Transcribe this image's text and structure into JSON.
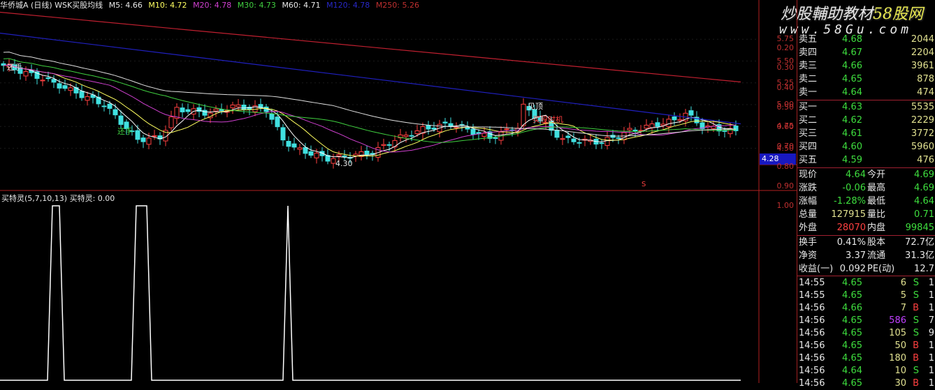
{
  "header": {
    "stock": "华侨城A (日线) WSK买股均线",
    "m5": "M5: 4.66",
    "m10": "M10: 4.72",
    "m20": "M20: 4.78",
    "m30": "M30: 4.73",
    "m60": "M60: 4.71",
    "m120": "M120: 4.78",
    "m250": "M250: 5.26"
  },
  "colors": {
    "m5": "#ffffff",
    "m10": "#ffff60",
    "m20": "#d040d0",
    "m30": "#40d040",
    "m60": "#e0e0e0",
    "m120": "#2020c0",
    "m250": "#c02030",
    "up": "#ff4040",
    "down": "#40e0e0"
  },
  "watermark": {
    "line1": "炒股輔助教材",
    "line1b": "58股网",
    "line2": "www.58Gu.com"
  },
  "price_axis": [
    "5.75",
    "5.50",
    "5.25",
    "5.00",
    "4.75",
    "4.50"
  ],
  "cursor_price": "4.28",
  "annotations": {
    "low": "4.30",
    "peak": "见顶",
    "buy": "买股时机",
    "left": "还手",
    "s_mark": "S"
  },
  "indicator": {
    "title": "买特灵(5,7,10,13)",
    "value": "买特灵: 0.00",
    "axis": [
      "1.00",
      "0.90",
      "0.80",
      "0.70",
      "0.60",
      "0.50",
      "0.40",
      "0.30",
      "0.20"
    ]
  },
  "chart_data": {
    "type": "candlestick",
    "price_path": [
      [
        0,
        5.45
      ],
      [
        7,
        5.3
      ],
      [
        18,
        5.0
      ],
      [
        24,
        4.6
      ],
      [
        28,
        4.62
      ],
      [
        31,
        4.95
      ],
      [
        37,
        4.9
      ],
      [
        41,
        4.98
      ],
      [
        47,
        4.95
      ],
      [
        50,
        4.6
      ],
      [
        52,
        4.5
      ],
      [
        58,
        4.38
      ],
      [
        66,
        4.45
      ],
      [
        70,
        4.6
      ],
      [
        75,
        4.72
      ],
      [
        80,
        4.78
      ],
      [
        87,
        4.62
      ],
      [
        92,
        4.75
      ],
      [
        93,
        4.98
      ],
      [
        100,
        4.6
      ],
      [
        107,
        4.57
      ],
      [
        112,
        4.7
      ],
      [
        120,
        4.82
      ],
      [
        122,
        4.9
      ],
      [
        125,
        4.75
      ],
      [
        132,
        4.68
      ]
    ],
    "m120": [
      5.82,
      4.78
    ],
    "m250": [
      6.06,
      5.26
    ],
    "indicator_spikes": [
      [
        68,
        75,
        85,
        92
      ],
      [
        188,
        195,
        210,
        217
      ],
      [
        405,
        412,
        412,
        419
      ]
    ]
  },
  "quote": {
    "asks": [
      {
        "l": "卖五",
        "p": "4.68",
        "v": "2044"
      },
      {
        "l": "卖四",
        "p": "4.67",
        "v": "2204"
      },
      {
        "l": "卖三",
        "p": "4.66",
        "v": "3961"
      },
      {
        "l": "卖二",
        "p": "4.65",
        "v": "878"
      },
      {
        "l": "卖一",
        "p": "4.64",
        "v": "474"
      }
    ],
    "bids": [
      {
        "l": "买一",
        "p": "4.63",
        "v": "5535"
      },
      {
        "l": "买二",
        "p": "4.62",
        "v": "2229"
      },
      {
        "l": "买三",
        "p": "4.61",
        "v": "3772"
      },
      {
        "l": "买四",
        "p": "4.60",
        "v": "5960"
      },
      {
        "l": "买五",
        "p": "4.59",
        "v": "476"
      }
    ],
    "stats": [
      {
        "a": "现价",
        "av": "4.64",
        "b": "今开",
        "bv": "4.69",
        "ac": "g",
        "bc": "g"
      },
      {
        "a": "涨跌",
        "av": "-0.06",
        "b": "最高",
        "bv": "4.69",
        "ac": "g",
        "bc": "g"
      },
      {
        "a": "涨幅",
        "av": "-1.28%",
        "b": "最低",
        "bv": "4.64",
        "ac": "g",
        "bc": "g"
      },
      {
        "a": "总量",
        "av": "127915",
        "b": "量比",
        "bv": "0.71",
        "ac": "y",
        "bc": "g"
      },
      {
        "a": "外盘",
        "av": "28070",
        "b": "内盘",
        "bv": "99845",
        "ac": "r",
        "bc": "g"
      }
    ],
    "fin": [
      {
        "a": "换手",
        "av": "0.41%",
        "b": "股本",
        "bv": "72.7亿"
      },
      {
        "a": "净资",
        "av": "3.37",
        "b": "流通",
        "bv": "31.3亿"
      },
      {
        "a": "收益(一)",
        "av": "0.092",
        "b": "PE(动)",
        "bv": "12.7"
      }
    ],
    "ticks": [
      {
        "t": "14:55",
        "p": "4.65",
        "v": "6",
        "s": "S",
        "n": "1",
        "vc": "y"
      },
      {
        "t": "14:55",
        "p": "4.65",
        "v": "5",
        "s": "S",
        "n": "1",
        "vc": "y"
      },
      {
        "t": "14:56",
        "p": "4.66",
        "v": "7",
        "s": "B",
        "n": "1",
        "vc": "y"
      },
      {
        "t": "14:56",
        "p": "4.65",
        "v": "586",
        "s": "S",
        "n": "7",
        "vc": "p"
      },
      {
        "t": "14:56",
        "p": "4.65",
        "v": "105",
        "s": "S",
        "n": "9",
        "vc": "y"
      },
      {
        "t": "14:56",
        "p": "4.65",
        "v": "50",
        "s": "B",
        "n": "1",
        "vc": "y"
      },
      {
        "t": "14:56",
        "p": "4.65",
        "v": "180",
        "s": "B",
        "n": "1",
        "vc": "y"
      },
      {
        "t": "14:56",
        "p": "4.64",
        "v": "10",
        "s": "S",
        "n": "1",
        "vc": "y"
      },
      {
        "t": "14:56",
        "p": "4.65",
        "v": "30",
        "s": "B",
        "n": "1",
        "vc": "y"
      }
    ]
  }
}
